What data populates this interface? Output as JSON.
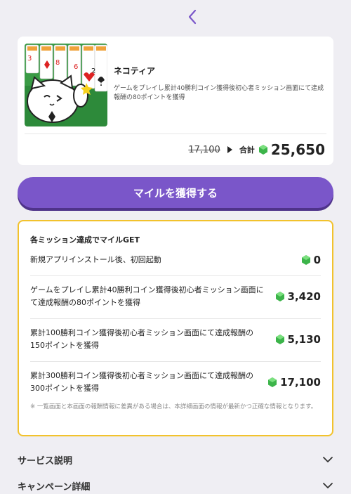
{
  "app": {
    "name": "ネコティア",
    "description": "ゲームをプレイし累計40勝利コイン獲得後初心者ミッション画面にて達成報酬の80ポイントを獲得",
    "old_price": "17,100",
    "total_label": "合計",
    "total_value": "25,650"
  },
  "cta": {
    "label": "マイルを獲得する"
  },
  "missions": {
    "title": "各ミッション達成でマイルGET",
    "items": [
      {
        "text": "新規アプリインストール後、初回起動",
        "points": "0"
      },
      {
        "text": "ゲームをプレイし累計40勝利コイン獲得後初心者ミッション画面にて達成報酬の80ポイントを獲得",
        "points": "3,420"
      },
      {
        "text": "累計100勝利コイン獲得後初心者ミッション画面にて達成報酬の150ポイントを獲得",
        "points": "5,130"
      },
      {
        "text": "累計300勝利コイン獲得後初心者ミッション画面にて達成報酬の300ポイントを獲得",
        "points": "17,100"
      }
    ],
    "note": "※ 一覧画面と本画面の報酬情報に差異がある場合は、本詳細画面の情報が最新かつ正確な情報となります。"
  },
  "sections": [
    {
      "label": "サービス説明"
    },
    {
      "label": "キャンペーン詳細"
    }
  ],
  "icons": {
    "back": "chevron-left-icon",
    "gem": "green-gem-icon",
    "expand": "chevron-down-icon"
  },
  "colors": {
    "accent": "#7a56c9",
    "mission_border": "#f2c22c",
    "gem": "#3cb44a"
  }
}
